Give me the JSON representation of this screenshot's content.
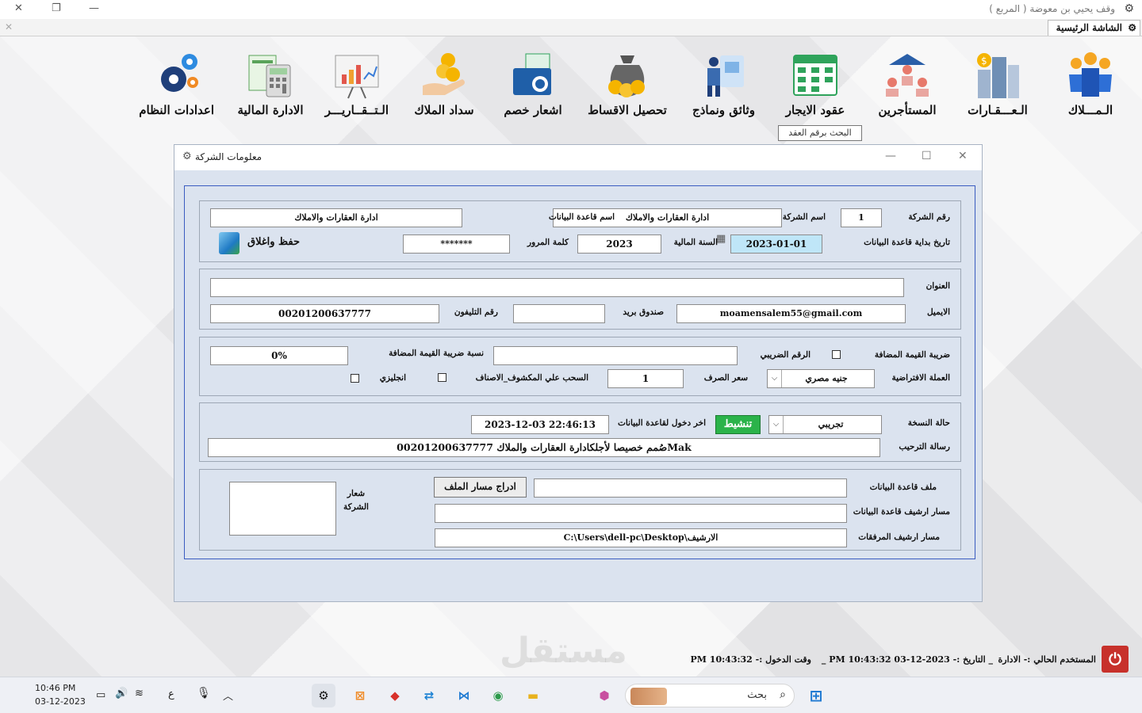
{
  "window": {
    "title": "وقف يحيي بن معوضة ( المربع )",
    "tab_label": "الشاشة الرئيسية"
  },
  "toolbar": {
    "items": [
      {
        "label": "الـمـــلاك",
        "icon": "owners-icon"
      },
      {
        "label": "الـعـــقـارات",
        "icon": "buildings-icon"
      },
      {
        "label": "المستأجرين",
        "icon": "tenants-icon"
      },
      {
        "label": "عقود الايجار",
        "icon": "contracts-calendar-icon"
      },
      {
        "label": "وثائق ونماذج",
        "icon": "documents-icon"
      },
      {
        "label": "تحصيل الاقساط",
        "icon": "money-bag-icon"
      },
      {
        "label": "اشعار خصم",
        "icon": "discount-notice-icon"
      },
      {
        "label": "سداد الملاك",
        "icon": "coins-hand-icon"
      },
      {
        "label": "الـتــقــاريـــر",
        "icon": "reports-board-icon"
      },
      {
        "label": "الادارة المالية",
        "icon": "finance-calculator-icon"
      },
      {
        "label": "اعدادات النظام",
        "icon": "gears-icon"
      }
    ],
    "tooltip": "البحث برقم العقد"
  },
  "dialog": {
    "title": "معلومات الشركة",
    "group1": {
      "company_no_label": "رقم الشركة",
      "company_no": "1",
      "company_name_label": "اسم الشركة",
      "company_name": "ادارة العقارات والاملاك",
      "db_name_label": "اسم قاعدة البيانات",
      "db_name": "ادارة العقارات والاملاك",
      "db_start_label": "تاريخ بداية قاعدة البيانات",
      "db_start": "2023-01-01",
      "fiscal_year_label": "السنة المالية",
      "fiscal_year": "2023",
      "password_label": "كلمة المرور",
      "password": "*******",
      "save_close": "حفظ واغلاق"
    },
    "group2": {
      "address_label": "العنوان",
      "address": "",
      "email_label": "الايميل",
      "email": "moamensalem55@gmail.com",
      "pobox_label": "صندوق بريد",
      "pobox": "",
      "phone_label": "رقم التليفون",
      "phone": "00201200637777"
    },
    "group3": {
      "vat_label": "ضريبة القيمة المضافة",
      "tax_no_label": "الرقم الضريبي",
      "tax_no": "",
      "vat_rate_label": "نسبة ضريبة القيمة المضافة",
      "vat_rate": "0%",
      "currency_label": "العملة الافتراضية",
      "currency": "جنيه مصري",
      "exchange_label": "سعر الصرف",
      "exchange": "1",
      "withdraw_label": "السحب علي المكشوف_الاصناف",
      "english_label": "انجليزي"
    },
    "group4": {
      "version_label": "حالة النسخة",
      "version": "تجريبي",
      "activate": "تنشيط",
      "last_login_label": "اخر دخول لقاعدة البيانات",
      "last_login": "2023-12-03   22:46:13",
      "welcome_label": "رسالة الترحيب",
      "welcome": "Makصُمم خصيصا لأجلكادارة العقارات والملاك  00201200637777"
    },
    "group5": {
      "db_file_label": "ملف قاعدة البيانات",
      "db_file": "",
      "insert_path": "ادراج  مسار الملف",
      "db_archive_label": "مسار ارشيف قاعدة البيانات",
      "db_archive": "",
      "attach_archive_label": "مسار ارشيف المرفقات",
      "attach_archive": "C:\\Users\\dell-pc\\Desktop\\الارشيف",
      "logo_label": "شعار الشركة"
    }
  },
  "status": {
    "user": "المستخدم الحالي :- الادارة",
    "date": "_  التاريخ :- 2023-12-03 PM 10:43:32  _",
    "login_time": "وقت الدخول :- PM 10:43:32"
  },
  "taskbar": {
    "time": "10:46 PM",
    "date": "03-12-2023",
    "lang": "ع",
    "search": "بحث"
  },
  "watermark": "مستقل",
  "colors": {
    "accent_green": "#2bb34a",
    "frame_blue": "#3a5cc0",
    "dialog_bg": "#dbe3ef",
    "power_red": "#c7312b"
  }
}
